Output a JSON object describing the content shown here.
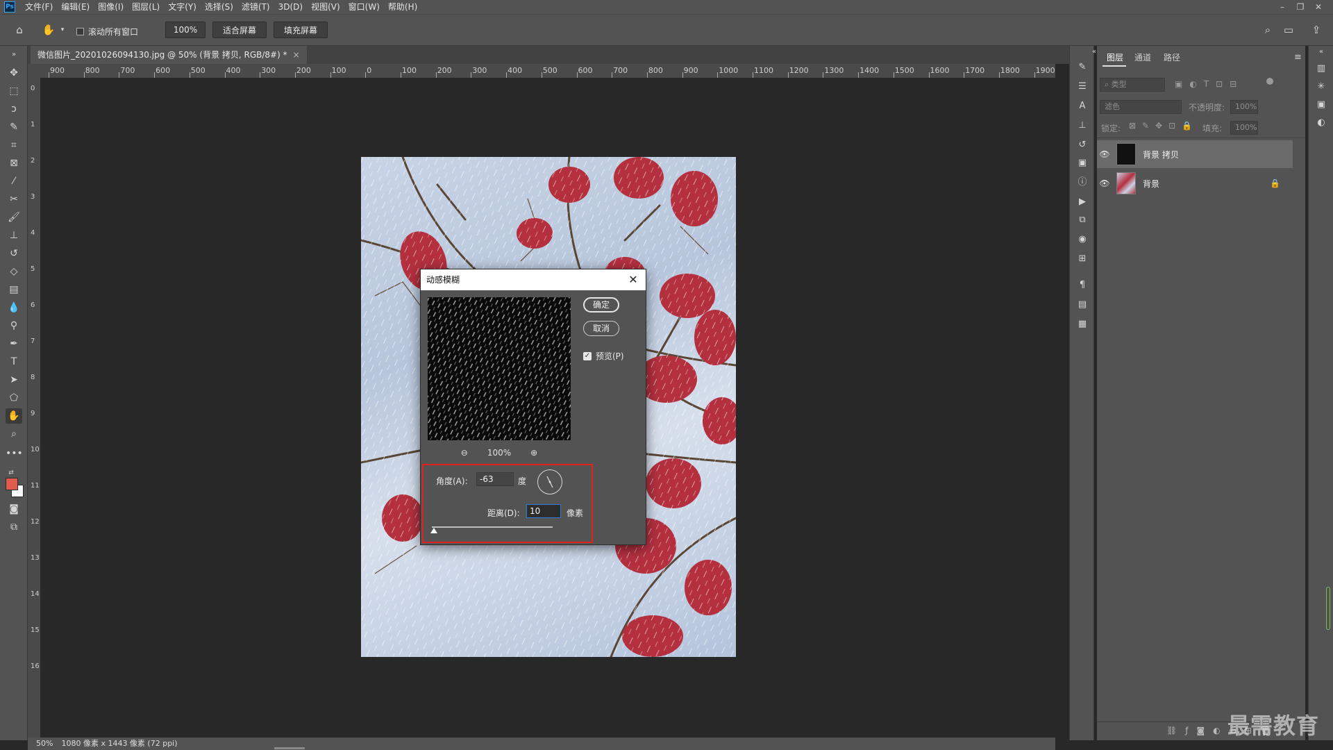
{
  "menubar": {
    "logo": "Ps",
    "items": [
      "文件(F)",
      "编辑(E)",
      "图像(I)",
      "图层(L)",
      "文字(Y)",
      "选择(S)",
      "滤镜(T)",
      "3D(D)",
      "视图(V)",
      "窗口(W)",
      "帮助(H)"
    ]
  },
  "options": {
    "scroll_all_label": "滚动所有窗口",
    "zoom_value": "100%",
    "fit_screen": "适合屏幕",
    "fill_screen": "填充屏幕"
  },
  "document": {
    "tab_title": "微信图片_20201026094130.jpg @ 50% (背景 拷贝, RGB/8#) *",
    "tab_close": "×"
  },
  "ruler": {
    "top_labels": [
      "900",
      "800",
      "700",
      "600",
      "500",
      "400",
      "300",
      "200",
      "100",
      "0",
      "100",
      "200",
      "300",
      "400",
      "500",
      "600",
      "700",
      "800",
      "900",
      "1000",
      "1100",
      "1200",
      "1300",
      "1400",
      "1500",
      "1600",
      "1700",
      "1800",
      "1900"
    ],
    "left_labels": [
      "0",
      "1",
      "2",
      "3",
      "4",
      "5",
      "6",
      "7",
      "8",
      "9",
      "10",
      "11",
      "12",
      "13",
      "14",
      "15",
      "16"
    ]
  },
  "status": {
    "zoom": "50%",
    "doc_info": "1080 像素 x 1443 像素 (72 ppi)"
  },
  "layers_panel": {
    "tabs": [
      "图层",
      "通道",
      "路径"
    ],
    "active_tab": 0,
    "search_placeholder": "类型",
    "blend_mode": "滤色",
    "opacity_label": "不透明度:",
    "opacity_value": "100%",
    "lock_label": "锁定:",
    "fill_label": "填充:",
    "fill_value": "100%",
    "layers": [
      {
        "name": "背景 拷贝",
        "selected": true,
        "locked": false
      },
      {
        "name": "背景",
        "selected": false,
        "locked": true
      }
    ]
  },
  "dialog": {
    "title": "动感模糊",
    "ok_label": "确定",
    "cancel_label": "取消",
    "preview_label": "预览(P)",
    "preview_checked": true,
    "zoom_text": "100%",
    "angle_label": "角度(A):",
    "angle_value": "-63",
    "angle_unit": "度",
    "distance_label": "距离(D):",
    "distance_value": "10",
    "distance_unit": "像素"
  },
  "watermark": "最需教育",
  "colors": {
    "foreground": "#e25c4e",
    "background": "#ffffff",
    "highlight": "#e0211e",
    "focus": "#2f7bd8"
  }
}
